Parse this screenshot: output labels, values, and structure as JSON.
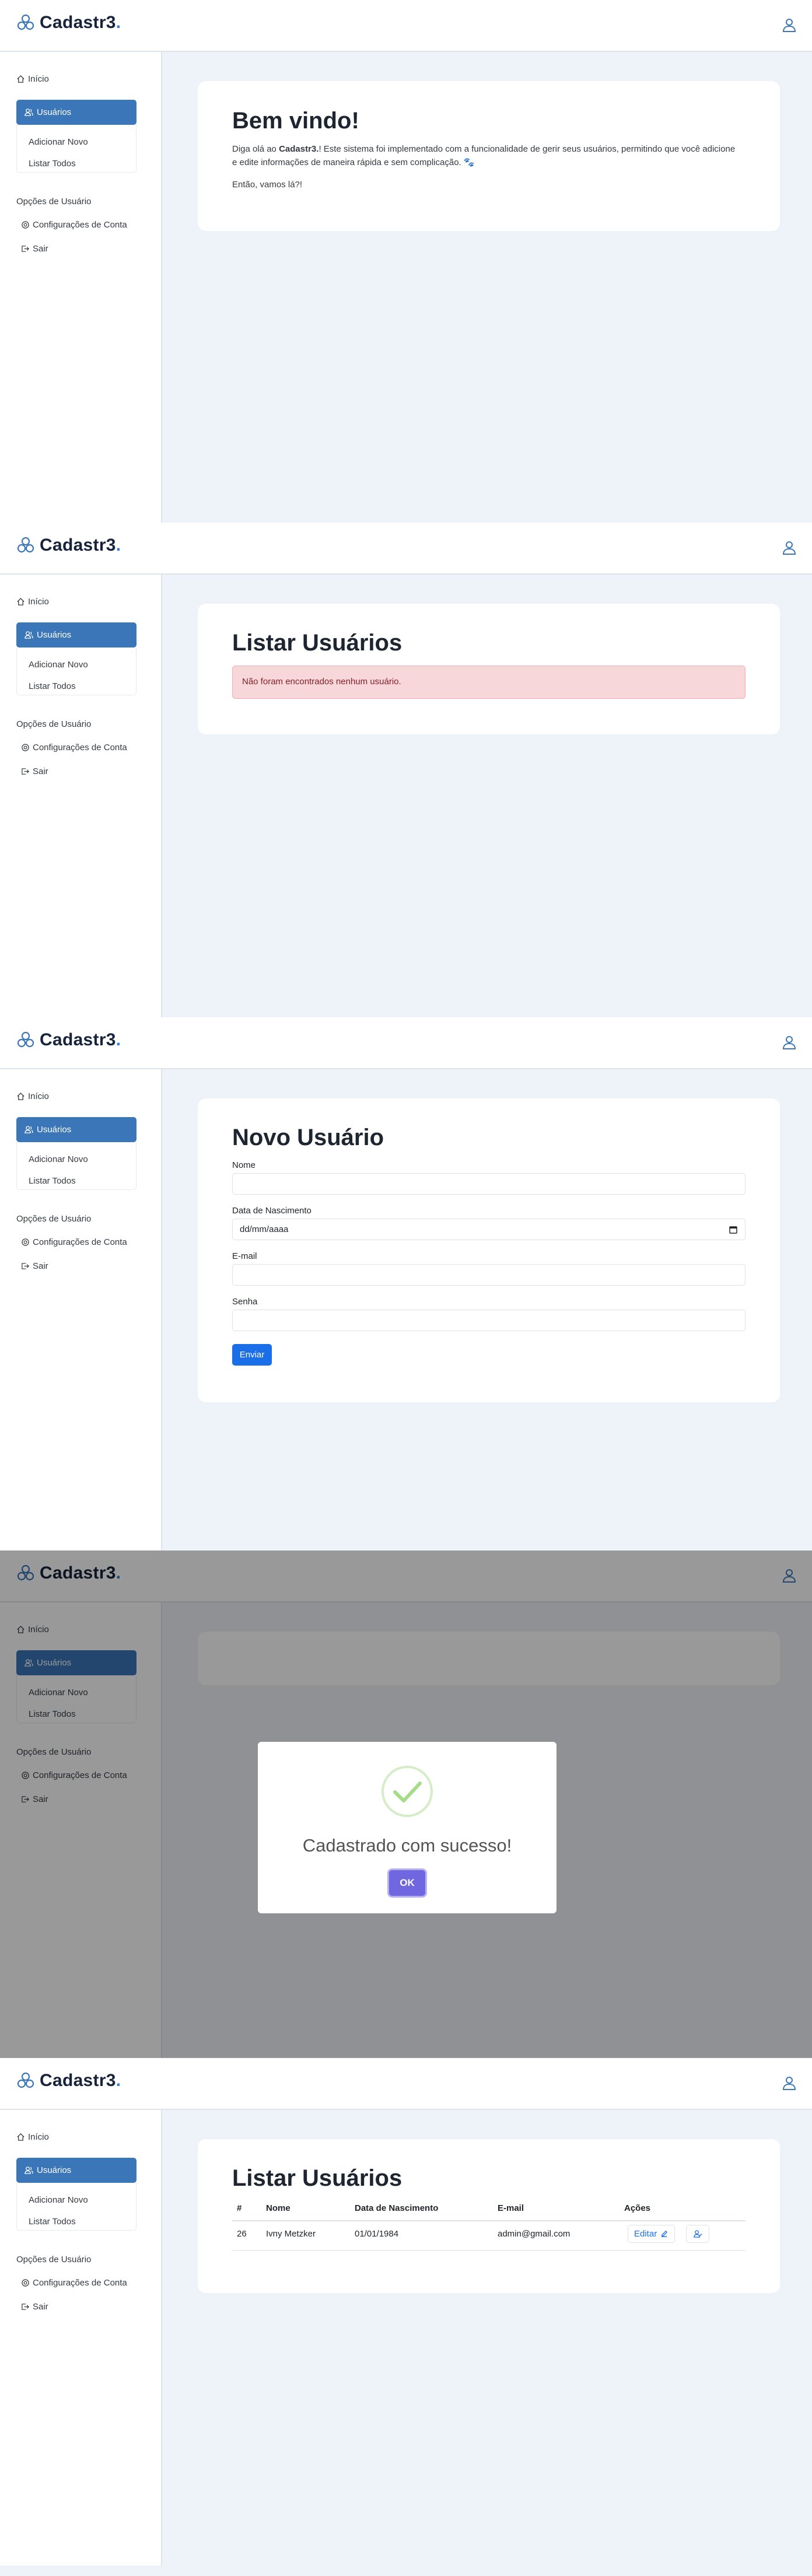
{
  "app": {
    "logo_text": "Cadastr3",
    "logo_dot": ".",
    "brand_color": "#3b76b8"
  },
  "sidebar": {
    "home_label": "Início",
    "users_label": "Usuários",
    "add_new_label": "Adicionar Novo",
    "list_all_label": "Listar Todos",
    "user_options_title": "Opções de Usuário",
    "account_settings_label": "Configurações de Conta",
    "exit_label": "Sair"
  },
  "welcome": {
    "title": "Bem vindo!",
    "text_before": "Diga olá ao ",
    "text_brand": "Cadastr3.",
    "text_after": "! Este sistema foi implementado com a funcionalidade de gerir seus usuários, permitindo que você adicione e edite informações de maneira rápida e sem complicação. 🐾",
    "cta": "Então, vamos lá?!"
  },
  "list_empty": {
    "title": "Listar Usuários",
    "alert": "Não foram encontrados nenhum usuário."
  },
  "new_user": {
    "title": "Novo Usuário",
    "name_label": "Nome",
    "birth_label": "Data de Nascimento",
    "birth_placeholder": "dd/mm/aaaa",
    "email_label": "E-mail",
    "password_label": "Senha",
    "submit_label": "Enviar"
  },
  "modal": {
    "title": "Cadastrado com sucesso!",
    "ok_label": "OK",
    "success_color": "#a5dc86"
  },
  "list_users": {
    "title": "Listar Usuários",
    "columns": [
      "#",
      "Nome",
      "Data de Nascimento",
      "E-mail",
      "Ações"
    ],
    "rows": [
      {
        "id": "26",
        "name": "Ivny Metzker",
        "birth": "01/01/1984",
        "email": "admin@gmail.com"
      }
    ],
    "edit_label": "Editar"
  }
}
